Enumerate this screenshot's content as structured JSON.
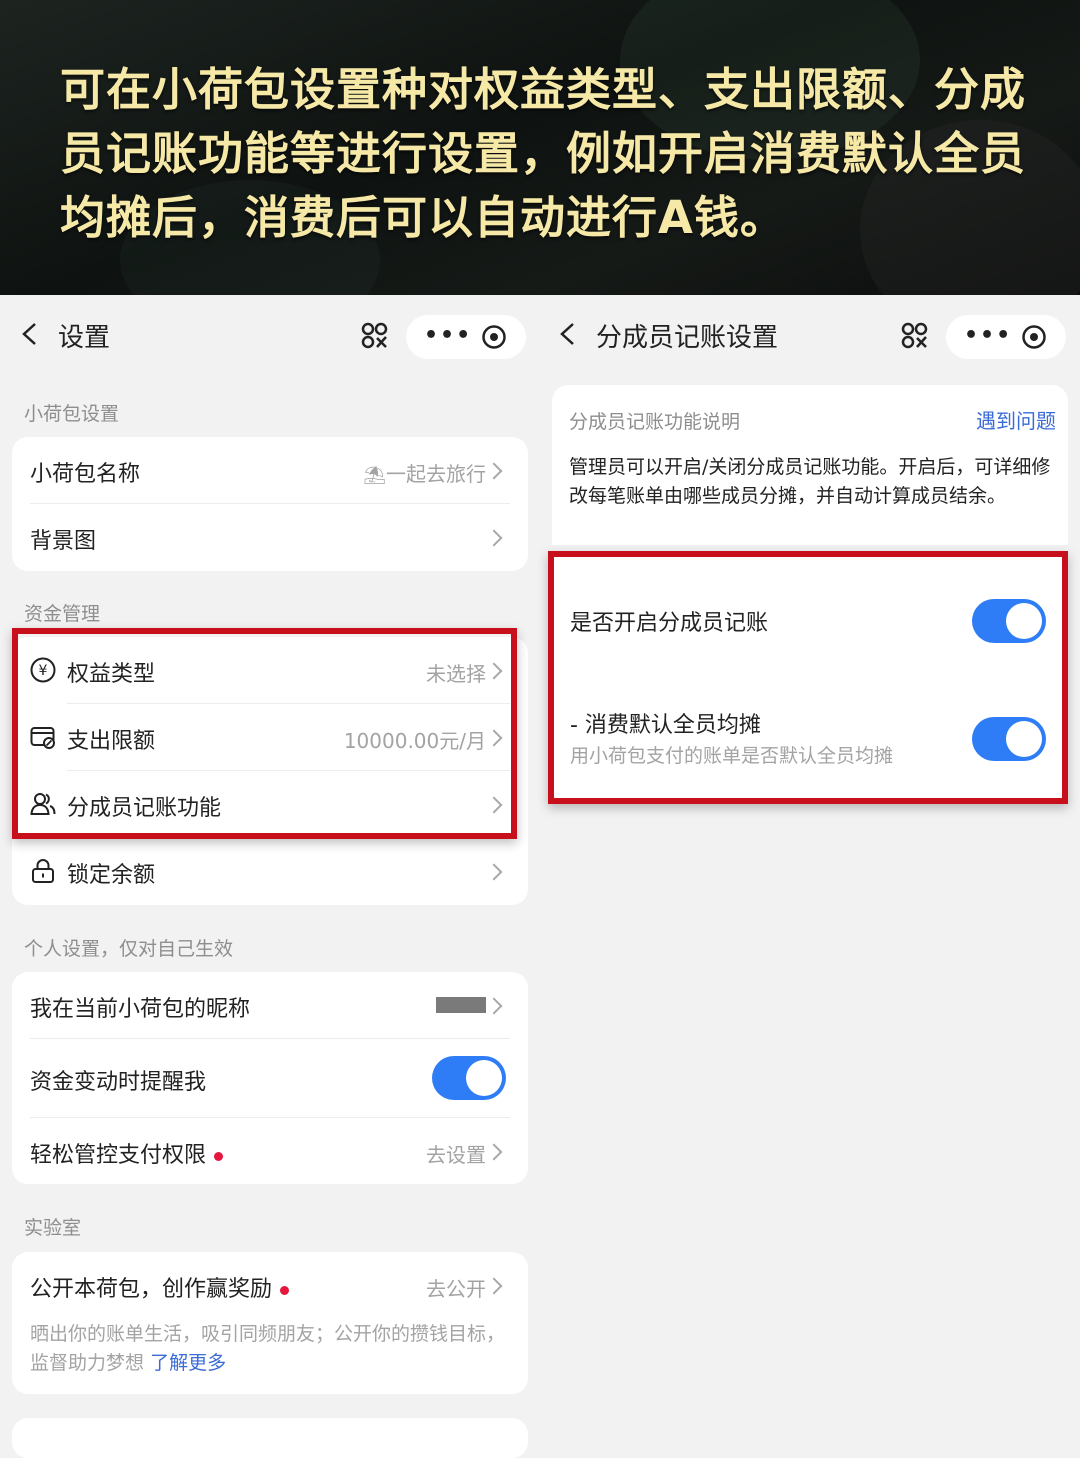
{
  "banner": {
    "caption": "可在小荷包设置种对权益类型、支出限额、分成员记账功能等进行设置，例如开启消费默认全员均摊后，消费后可以自动进行A钱。"
  },
  "left": {
    "title": "设置",
    "section_wallet": "小荷包设置",
    "wallet_name_label": "小荷包名称",
    "wallet_name_value": "一起去旅行",
    "background_label": "背景图",
    "section_funds": "资金管理",
    "rights_type_label": "权益类型",
    "rights_type_value": "未选择",
    "spending_limit_label": "支出限额",
    "spending_limit_value": "10000.00元/月",
    "member_booking_label": "分成员记账功能",
    "lock_balance_label": "锁定余额",
    "section_personal": "个人设置，仅对自己生效",
    "nickname_label": "我在当前小荷包的昵称",
    "notify_label": "资金变动时提醒我",
    "notify_on": true,
    "payment_control_label": "轻松管控支付权限",
    "payment_control_value": "去设置",
    "section_lab": "实验室",
    "public_label": "公开本荷包，创作赢奖励",
    "public_value": "去公开",
    "public_desc": "晒出你的账单生活，吸引同频朋友；公开你的攒钱目标，监督助力梦想",
    "learn_more": "了解更多"
  },
  "right": {
    "title": "分成员记账设置",
    "desc_heading": "分成员记账功能说明",
    "help_link": "遇到问题",
    "desc_text": "管理员可以开启/关闭分成员记账功能。开启后，可详细修改每笔账单由哪些成员分摊，并自动计算成员结余。",
    "enable_label": "是否开启分成员记账",
    "enable_on": true,
    "split_label": "- 消费默认全员均摊",
    "split_desc": "用小荷包支付的账单是否默认全员均摊",
    "split_on": true
  },
  "colors": {
    "accent": "#2f7df6",
    "highlight_border": "#c8101c",
    "banner_text": "#f6e9a8",
    "red_dot": "#e5173c"
  }
}
